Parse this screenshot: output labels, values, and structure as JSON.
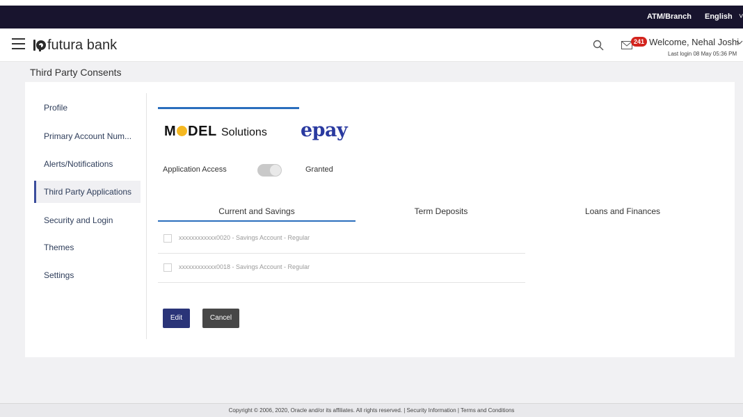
{
  "topbar": {
    "atm_branch": "ATM/Branch",
    "language": "English"
  },
  "header": {
    "brand": "futura bank",
    "notification_count": "241",
    "welcome": "Welcome, Nehal Joshi",
    "last_login": "Last login 08 May 05:36 PM"
  },
  "page": {
    "title": "Third Party Consents"
  },
  "nav": {
    "items": [
      {
        "label": "Profile"
      },
      {
        "label": "Primary Account Num..."
      },
      {
        "label": "Alerts/Notifications"
      },
      {
        "label": "Third Party Applications"
      },
      {
        "label": "Security and Login"
      },
      {
        "label": "Themes"
      },
      {
        "label": "Settings"
      }
    ],
    "active": "Third Party Applications"
  },
  "tpp": {
    "model_logo_pre": "M",
    "model_logo_post": "DEL",
    "model_logo_suffix": "Solutions",
    "epay_logo": "epay"
  },
  "access": {
    "label": "Application Access",
    "status": "Granted",
    "enabled": true
  },
  "tabs": [
    {
      "label": "Current and Savings"
    },
    {
      "label": "Term Deposits"
    },
    {
      "label": "Loans and Finances"
    }
  ],
  "active_tab": "Current and Savings",
  "accounts": [
    {
      "label": "xxxxxxxxxxxx0020 - Savings Account - Regular",
      "checked": false
    },
    {
      "label": "xxxxxxxxxxxx0018 - Savings Account - Regular",
      "checked": false
    }
  ],
  "actions": {
    "edit": "Edit",
    "cancel": "Cancel"
  },
  "footer": {
    "text": "Copyright © 2006, 2020, Oracle and/or its affiliates. All rights reserved. | Security Information | Terms and Conditions"
  },
  "colors": {
    "topbar": "#18142e",
    "accent_blue": "#2a6ebd",
    "primary_button": "#2a3478",
    "secondary_button": "#474747",
    "badge": "#d3241d",
    "epay": "#2a3aa0",
    "model_dot": "#f5b821"
  }
}
